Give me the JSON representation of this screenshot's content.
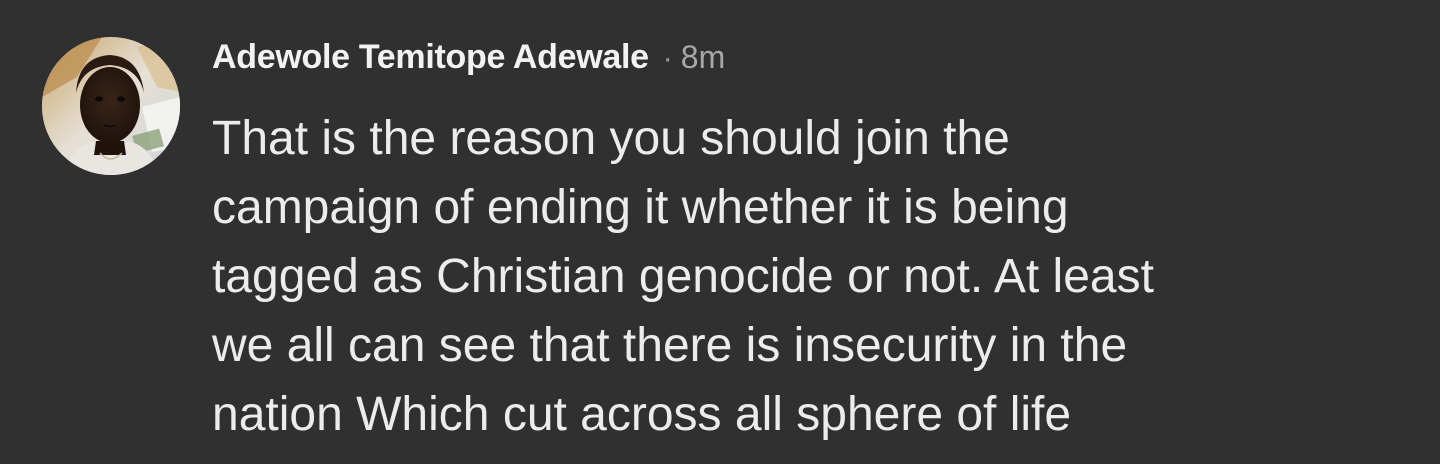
{
  "comment": {
    "author_name": "Adewole Temitope Adewale",
    "separator": "·",
    "timestamp": "8m",
    "text_lines": [
      "That is the reason you should join the",
      "campaign of ending it whether it is being",
      "tagged as Christian genocide or not. At least",
      "we all can see that there is insecurity in the",
      "nation Which cut across all sphere of life"
    ],
    "avatar": {
      "icon": "user-avatar-photo"
    }
  },
  "colors": {
    "background": "#303030",
    "primary_text": "#ececec",
    "secondary_text": "#a8a8a8"
  }
}
